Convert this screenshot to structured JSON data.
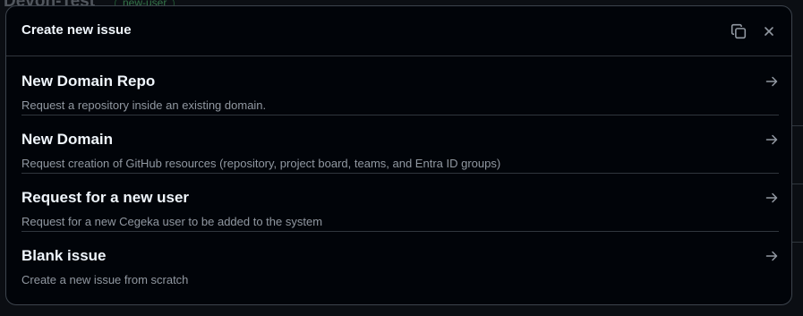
{
  "background": {
    "repo_title": "Devon-Test",
    "badge": "new-user"
  },
  "dialog": {
    "title": "Create new issue",
    "copy_icon": "copy-icon",
    "close_icon": "close-icon"
  },
  "templates": [
    {
      "title": "New Domain Repo",
      "description": "Request a repository inside an existing domain."
    },
    {
      "title": "New Domain",
      "description": "Request creation of GitHub resources (repository, project board, teams, and Entra ID groups)"
    },
    {
      "title": "Request for a new user",
      "description": "Request for a new Cegeka user to be added to the system"
    },
    {
      "title": "Blank issue",
      "description": "Create a new issue from scratch"
    }
  ],
  "colors": {
    "dialog_bg": "#010409",
    "border": "#30363d",
    "text_primary": "#f0f6fc",
    "text_muted": "#9198a1",
    "badge": "#4fb86c"
  }
}
